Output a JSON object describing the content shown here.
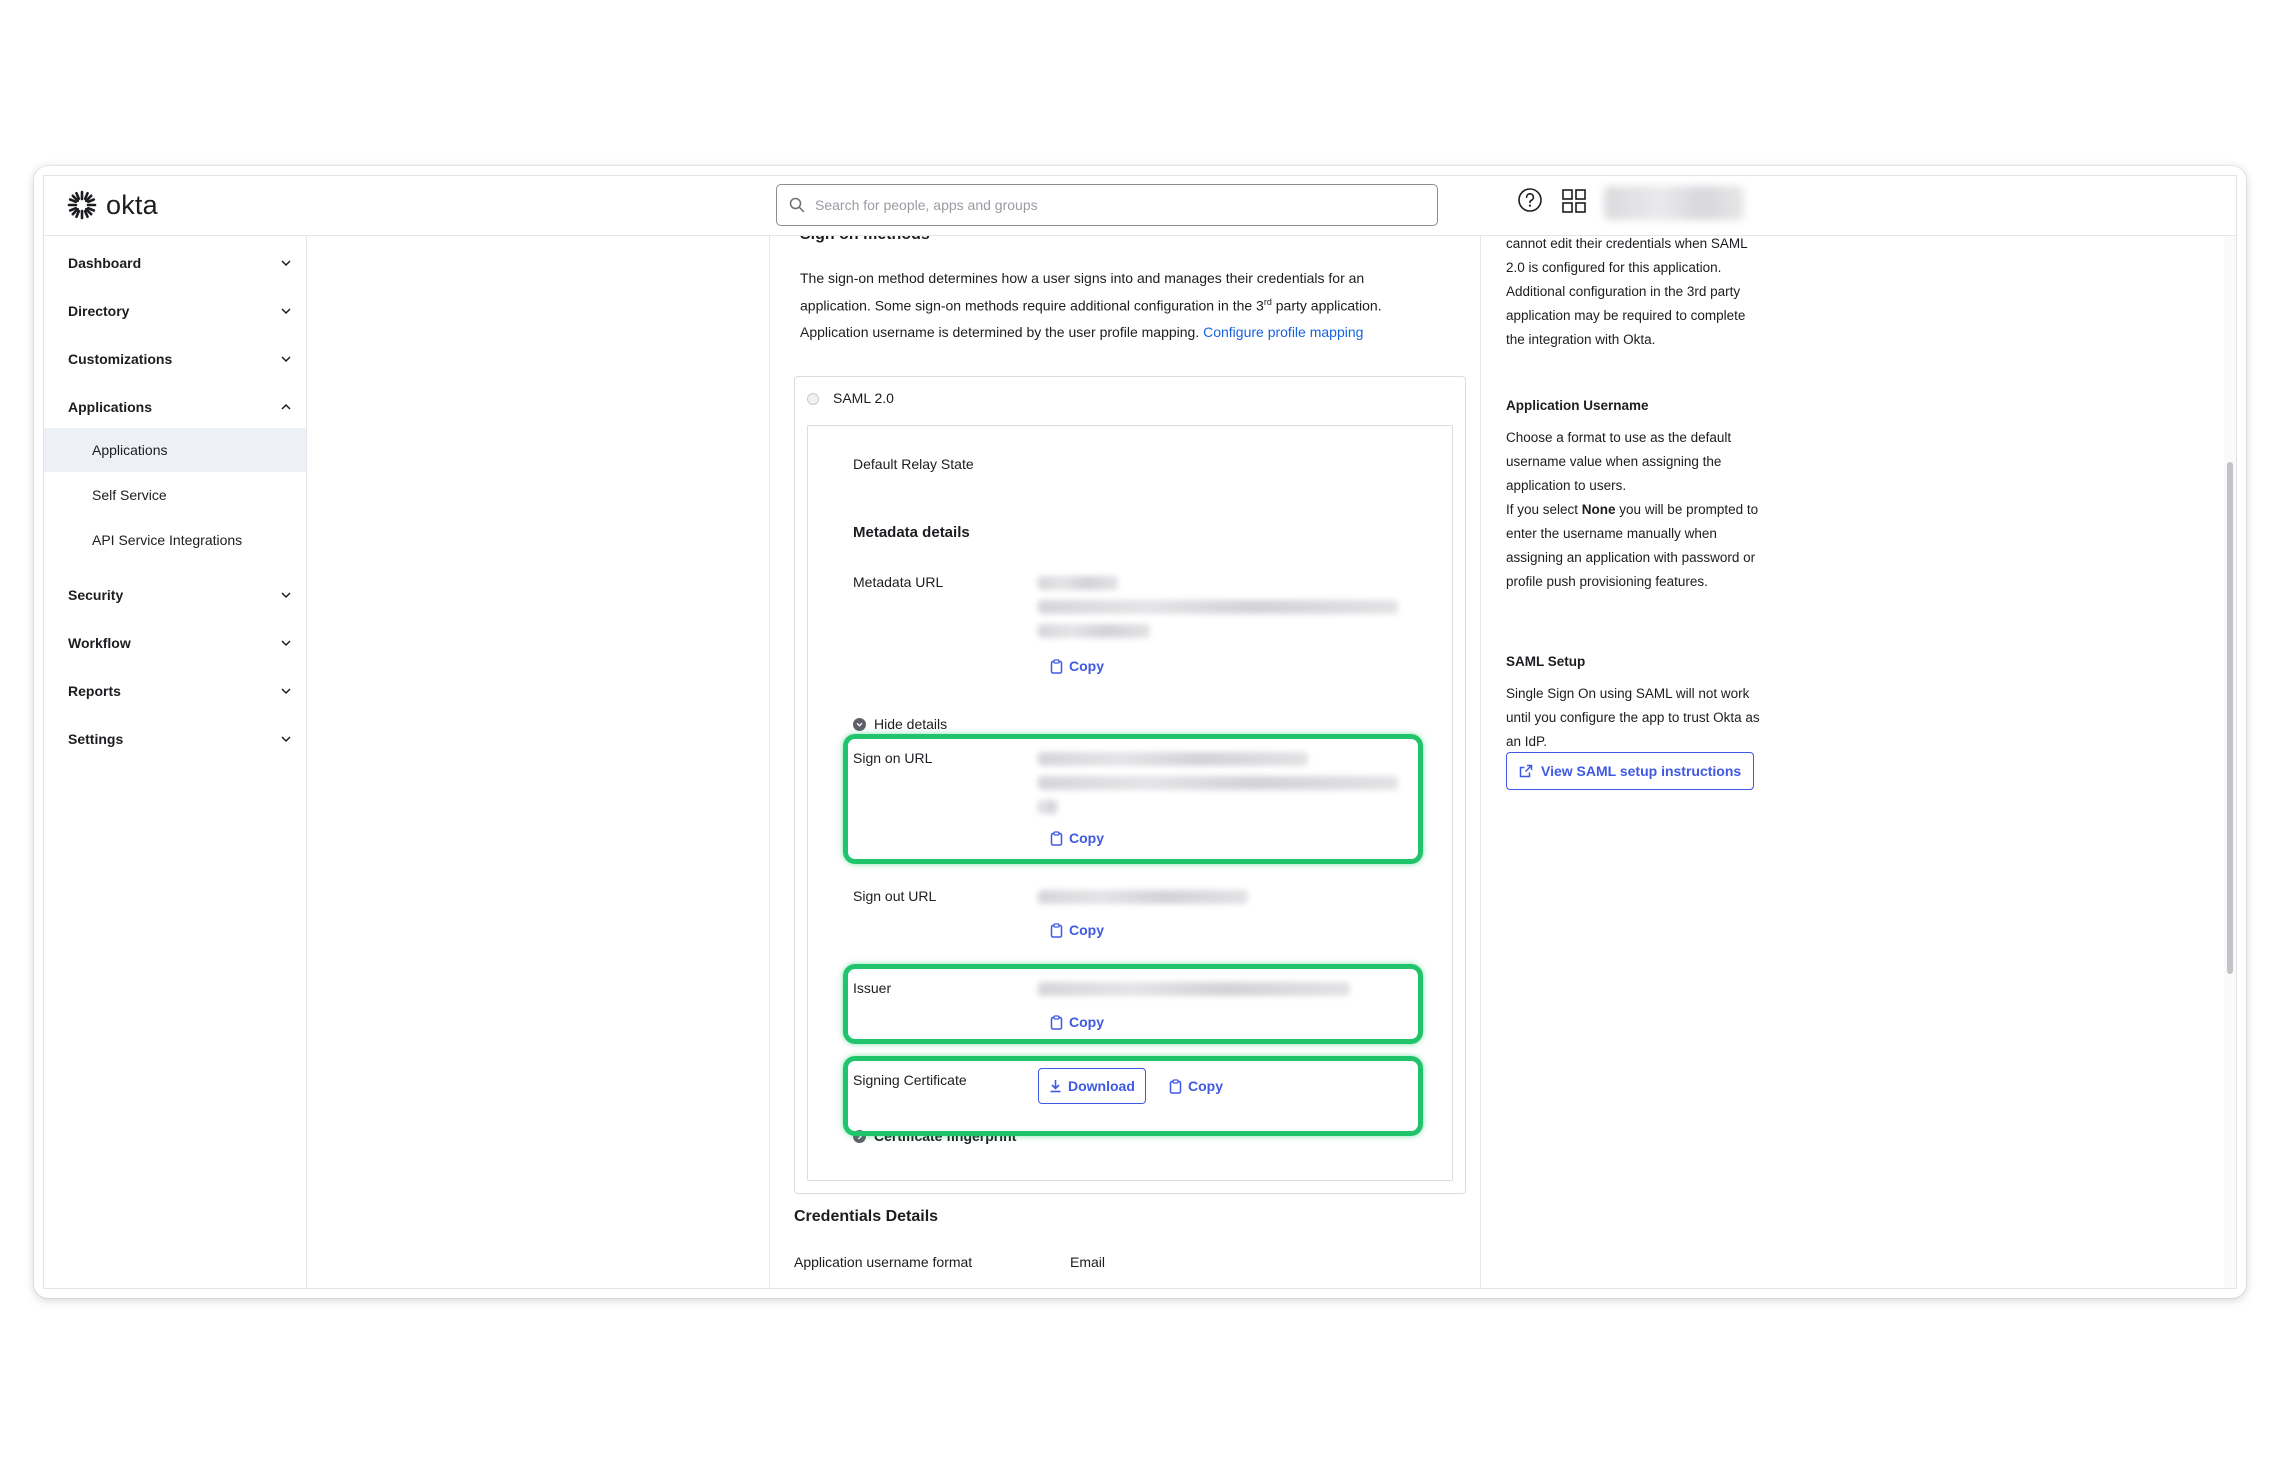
{
  "app": {
    "logo_text": "okta"
  },
  "search": {
    "placeholder": "Search for people, apps and groups"
  },
  "sidebar": {
    "items": [
      {
        "label": "Dashboard"
      },
      {
        "label": "Directory"
      },
      {
        "label": "Customizations"
      },
      {
        "label": "Applications",
        "expanded": true
      },
      {
        "label": "Security"
      },
      {
        "label": "Workflow"
      },
      {
        "label": "Reports"
      },
      {
        "label": "Settings"
      }
    ],
    "sub_items": [
      {
        "label": "Applications",
        "active": true
      },
      {
        "label": "Self Service"
      },
      {
        "label": "API Service Integrations"
      }
    ]
  },
  "main": {
    "section_heading": "Sign on methods",
    "intro_1": "The sign-on method determines how a user signs into and manages their credentials for an",
    "intro_2a": "application. Some sign-on methods require additional configuration in the 3",
    "intro_2sup": "rd",
    "intro_2b": " party application.",
    "username_text": "Application username is determined by the user profile mapping. ",
    "username_link": "Configure profile mapping",
    "saml_label": "SAML 2.0",
    "default_relay_state": "Default Relay State",
    "metadata_details": "Metadata details",
    "metadata_url_label": "Metadata URL",
    "copy_label": "Copy",
    "hide_details": "Hide details",
    "sign_on_url_label": "Sign on URL",
    "sign_out_url_label": "Sign out URL",
    "issuer_label": "Issuer",
    "signing_cert_label": "Signing Certificate",
    "download_label": "Download",
    "cert_fingerprint": "Certificate fingerprint",
    "credentials_title": "Credentials Details",
    "username_format_label": "Application username format",
    "username_format_value": "Email"
  },
  "help": {
    "p1": "cannot edit their credentials when SAML 2.0 is configured for this application. Additional configuration in the 3rd party application may be required to complete the integration with Okta.",
    "h_username": "Application Username",
    "p2": "Choose a format to use as the default username value when assigning the application to users.",
    "p3_a": "If you select ",
    "p3_bold": "None",
    "p3_b": " you will be prompted to enter the username manually when assigning an application with password or profile push provisioning features.",
    "h_saml": "SAML Setup",
    "p4": "Single Sign On using SAML will not work until you configure the app to trust Okta as an IdP.",
    "view_saml_button": "View SAML setup instructions"
  },
  "colors": {
    "accent": "#3f59e4",
    "link": "#1662dd",
    "highlight": "#1fc46b"
  }
}
